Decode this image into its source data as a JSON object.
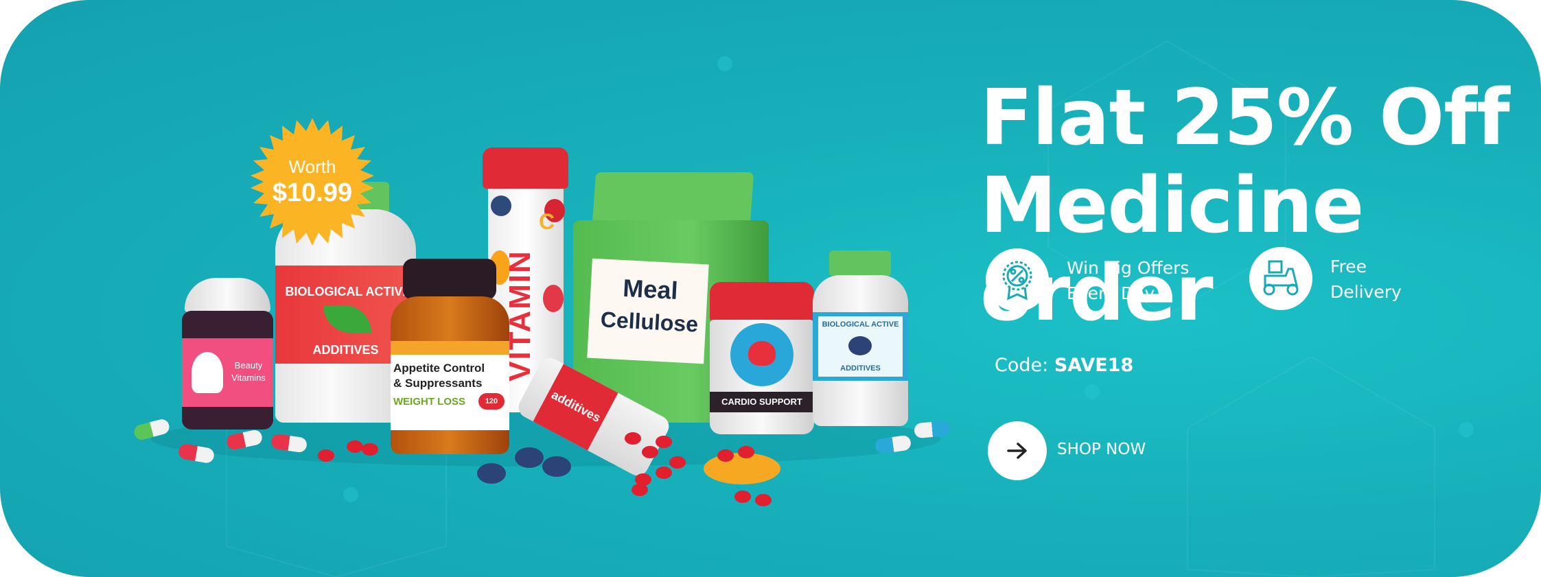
{
  "promo": {
    "title_line1": "Flat 25% Off",
    "title_line2": "Medicine order",
    "features": [
      {
        "icon": "discount-badge-icon",
        "line1": "Win Big Offers",
        "line2": "Every Day"
      },
      {
        "icon": "delivery-scooter-icon",
        "line1": "Free",
        "line2": "Delivery"
      }
    ],
    "code_label": "Code:",
    "code_value": "SAVE18",
    "cta_label": "SHOP NOW",
    "cta_icon": "arrow-right-icon"
  },
  "illustration": {
    "badge_line1": "Worth",
    "badge_line2": "$10.99",
    "beauty_label_1": "Beauty",
    "beauty_label_2": "Vitamins",
    "bio_label_top": "BIOLOGICAL ACTIVE",
    "bio_label_bottom": "ADDITIVES",
    "appetite_line1": "Appetite Control",
    "appetite_line2": "& Suppressants",
    "appetite_line3": "WEIGHT LOSS",
    "appetite_count": "120",
    "vitamin_text": "VITAMIN",
    "vitamin_c": "C",
    "bag_line1": "Meal",
    "bag_line2": "Cellulose",
    "cardio_label": "CARDIO SUPPORT",
    "small_bio_top": "BIOLOGICAL ACTIVE",
    "small_bio_bottom": "ADDITIVES",
    "fallen_label": "additives"
  },
  "colors": {
    "background": "#17aab6",
    "badge": "#fbb424",
    "accent_red": "#e8334a",
    "green": "#5cc55a"
  }
}
